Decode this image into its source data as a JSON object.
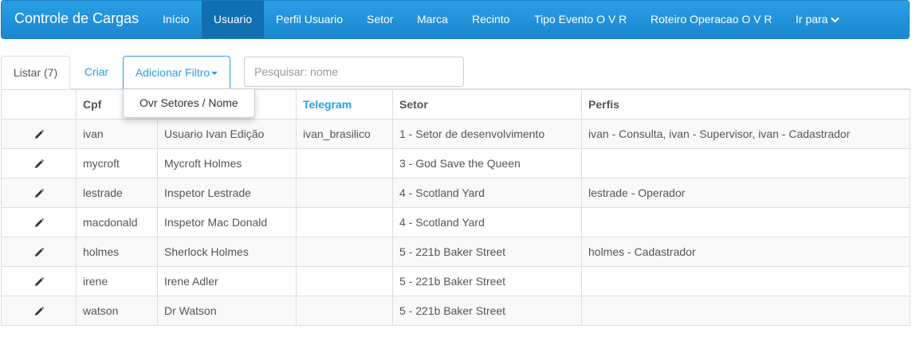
{
  "navbar": {
    "brand": "Controle de Cargas",
    "items": [
      {
        "label": "Início"
      },
      {
        "label": "Usuario",
        "active": true
      },
      {
        "label": "Perfil Usuario"
      },
      {
        "label": "Setor"
      },
      {
        "label": "Marca"
      },
      {
        "label": "Recinto"
      },
      {
        "label": "Tipo Evento O V R"
      },
      {
        "label": "Roteiro Operacao O V R"
      },
      {
        "label": "Ir para",
        "icon": "chevron-down-icon"
      }
    ],
    "colors": {
      "background": "#1a87d0",
      "active": "#0f6fb0"
    }
  },
  "tabs": {
    "list": "Listar (7)",
    "create": "Criar",
    "filter": "Adicionar Filtro"
  },
  "search": {
    "placeholder": "Pesquisar: nome",
    "value": ""
  },
  "filter_dropdown": {
    "items": [
      "Ovr Setores / Nome"
    ]
  },
  "table": {
    "headers": [
      "",
      "Cpf",
      "",
      "Telegram",
      "Setor",
      "Perfis"
    ],
    "rows": [
      {
        "cpf": "ivan",
        "nome": "Usuario Ivan Edição",
        "telegram": "ivan_brasilico",
        "setor": "1 - Setor de desenvolvimento",
        "perfis": "ivan - Consulta, ivan - Supervisor, ivan - Cadastrador"
      },
      {
        "cpf": "mycroft",
        "nome": "Mycroft Holmes",
        "telegram": "",
        "setor": "3 - God Save the Queen",
        "perfis": ""
      },
      {
        "cpf": "lestrade",
        "nome": "Inspetor Lestrade",
        "telegram": "",
        "setor": "4 - Scotland Yard",
        "perfis": "lestrade - Operador"
      },
      {
        "cpf": "macdonald",
        "nome": "Inspetor Mac Donald",
        "telegram": "",
        "setor": "4 - Scotland Yard",
        "perfis": ""
      },
      {
        "cpf": "holmes",
        "nome": "Sherlock Holmes",
        "telegram": "",
        "setor": "5 - 221b Baker Street",
        "perfis": "holmes - Cadastrador"
      },
      {
        "cpf": "irene",
        "nome": "Irene Adler",
        "telegram": "",
        "setor": "5 - 221b Baker Street",
        "perfis": ""
      },
      {
        "cpf": "watson",
        "nome": "Dr Watson",
        "telegram": "",
        "setor": "5 - 221b Baker Street",
        "perfis": ""
      }
    ],
    "row_icon": "pencil-icon"
  }
}
